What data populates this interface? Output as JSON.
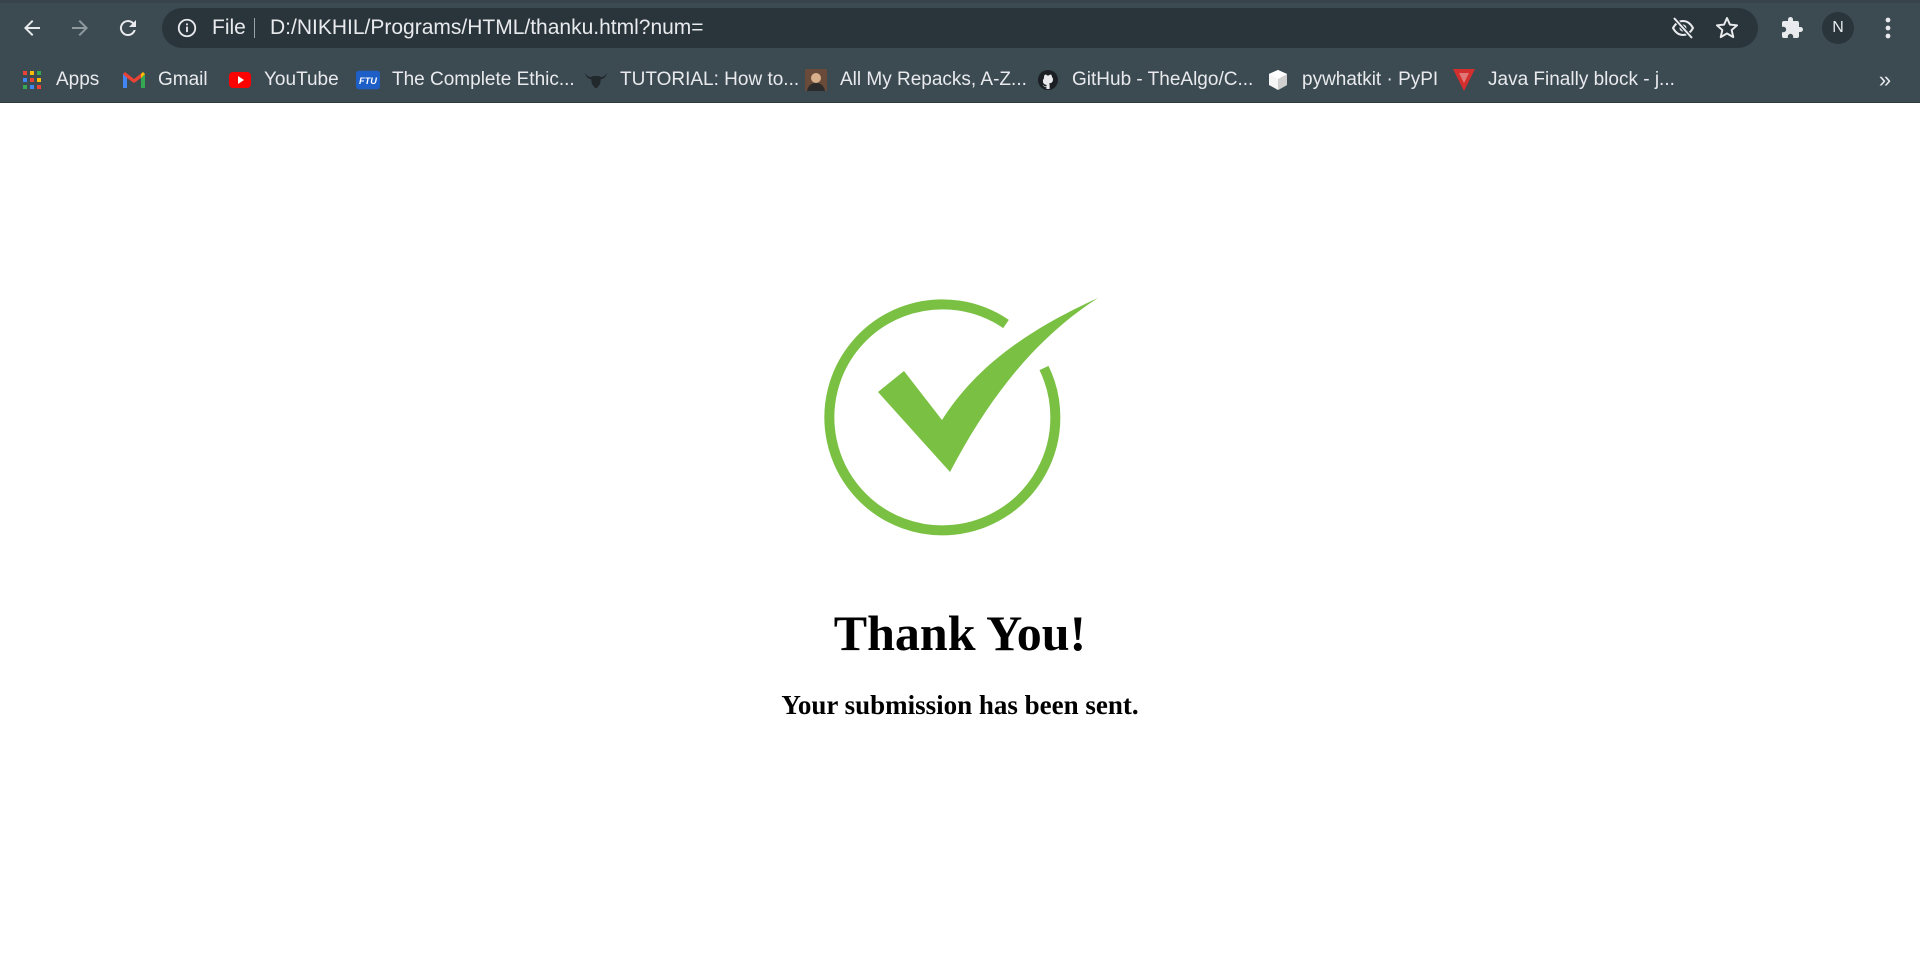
{
  "browser": {
    "omnibox": {
      "scheme_label": "File",
      "url": "D:/NIKHIL/Programs/HTML/thanku.html?num="
    },
    "profile_initial": "N",
    "bookmarks_overflow": "»",
    "bookmarks": [
      {
        "label": "Apps",
        "icon": "apps-grid-icon"
      },
      {
        "label": "Gmail",
        "icon": "gmail-icon"
      },
      {
        "label": "YouTube",
        "icon": "youtube-icon"
      },
      {
        "label": "The Complete Ethic...",
        "icon": "ftu-icon"
      },
      {
        "label": "TUTORIAL: How to...",
        "icon": "bull-icon"
      },
      {
        "label": "All My Repacks, A-Z...",
        "icon": "avatar-icon"
      },
      {
        "label": "GitHub - TheAlgo/C...",
        "icon": "github-icon"
      },
      {
        "label": "pywhatkit · PyPI",
        "icon": "pypi-icon"
      },
      {
        "label": "Java Finally block - j...",
        "icon": "java-icon"
      }
    ]
  },
  "page": {
    "icon": "check-circle-icon",
    "accent_color": "#7ac143",
    "title": "Thank You!",
    "subtitle": "Your submission has been sent."
  }
}
